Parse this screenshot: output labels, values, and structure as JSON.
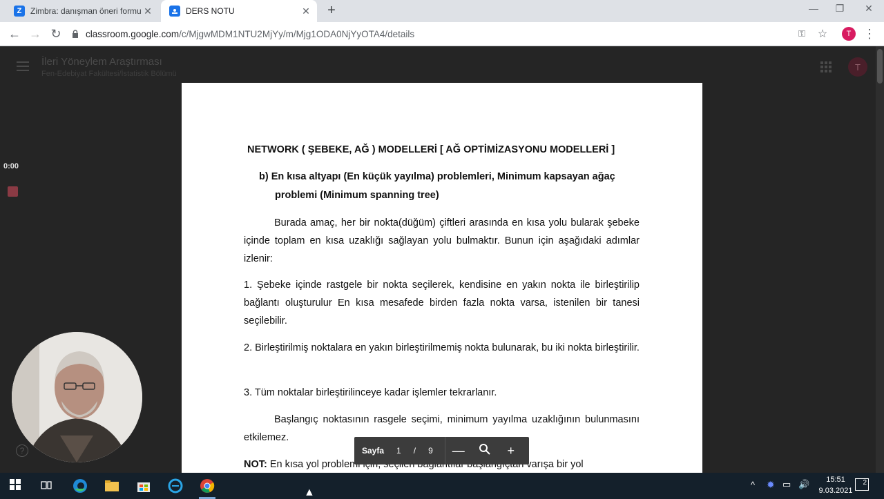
{
  "browser": {
    "tabs": [
      {
        "title": "Zimbra: danışman öneri formu",
        "favicon": "zimbra-icon",
        "color": "#1a73e8",
        "glyph": "Z"
      },
      {
        "title": "DERS NOTU",
        "favicon": "classroom-icon",
        "color": "#1e8e3e",
        "glyph": ""
      }
    ],
    "url_host": "classroom.google.com",
    "url_path": "/c/MjgwMDM1NTU2MjYy/m/Mjg1ODA0NjYyOTA4/details",
    "profile_initial": "T"
  },
  "classroom": {
    "course_title": "İleri Yöneylem Araştırması",
    "course_subtitle": "Fen-Edebiyat Fakültesi/İstatistik Bölümü",
    "avatar_initial": "T",
    "timer": "0:00"
  },
  "document": {
    "title": "NETWORK ( ŞEBEKE, AĞ ) MODELLERİ  [ AĞ OPTİMİZASYONU MODELLERİ ]",
    "section_b_line1": "b)  En kısa altyapı (En küçük yayılma) problemleri, Minimum kapsayan ağaç",
    "section_b_line2": "problemi  (Minimum spanning tree)",
    "intro": "Burada amaç, her bir nokta(düğüm) çiftleri arasında en kısa yolu bularak şebeke içinde toplam en kısa uzaklığı sağlayan yolu bulmaktır. Bunun için aşağıdaki adımlar izlenir:",
    "step1": "1.  Şebeke içinde rastgele bir nokta seçilerek, kendisine en yakın nokta ile birleştirilip bağlantı oluşturulur En kısa mesafede birden fazla nokta varsa, istenilen bir tanesi seçilebilir.",
    "step2": "2. Birleştirilmiş noktalara en yakın birleştirilmemiş nokta bulunarak, bu iki nokta birleştirilir.",
    "step3": "3. Tüm noktalar birleştirilinceye kadar işlemler tekrarlanır.",
    "start_note": "Başlangıç noktasının rasgele seçimi, minimum yayılma uzaklığının bulunmasını etkilemez.",
    "note_label": "NOT:",
    "note_text": " En kısa yol problemi için, seçilen bağlantılar başlangıçtan varışa bir yol"
  },
  "pager": {
    "label": "Sayfa",
    "current": "1",
    "separator": "/",
    "total": "9",
    "zoom_out": "—",
    "zoom_icon": "🔍",
    "zoom_in": "+"
  },
  "taskbar": {
    "time": "15:51",
    "date": "9.03.2021",
    "notifications": "2"
  }
}
